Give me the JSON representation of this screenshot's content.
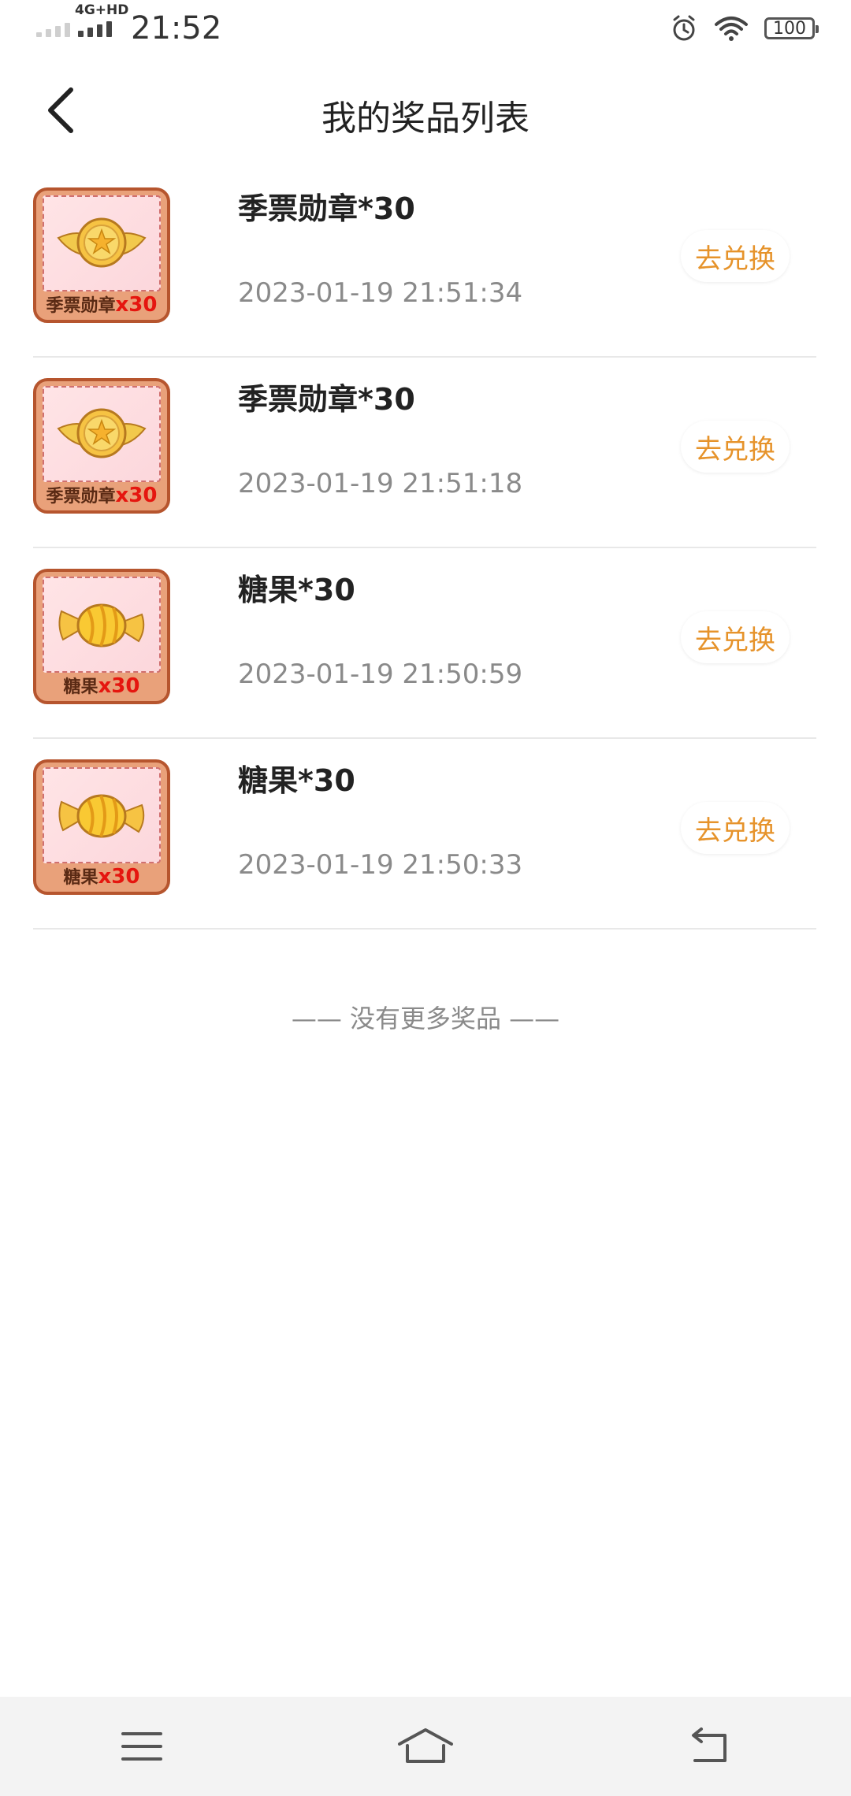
{
  "status": {
    "time": "21:52",
    "network": "4G+HD",
    "battery": "100"
  },
  "header": {
    "title": "我的奖品列表"
  },
  "prizes": [
    {
      "title": "季票勋章*30",
      "time": "2023-01-19 21:51:34",
      "thumb_name": "季票勋章",
      "thumb_qty": "x30",
      "icon": "medal-icon",
      "action": "去兑换"
    },
    {
      "title": "季票勋章*30",
      "time": "2023-01-19 21:51:18",
      "thumb_name": "季票勋章",
      "thumb_qty": "x30",
      "icon": "medal-icon",
      "action": "去兑换"
    },
    {
      "title": "糖果*30",
      "time": "2023-01-19 21:50:59",
      "thumb_name": "糖果",
      "thumb_qty": "x30",
      "icon": "candy-icon",
      "action": "去兑换"
    },
    {
      "title": "糖果*30",
      "time": "2023-01-19 21:50:33",
      "thumb_name": "糖果",
      "thumb_qty": "x30",
      "icon": "candy-icon",
      "action": "去兑换"
    }
  ],
  "footer": {
    "no_more": "—— 没有更多奖品 ——"
  },
  "colors": {
    "accent": "#e6932b",
    "qty_red": "#e5160f",
    "divider": "#e8e8e8"
  }
}
